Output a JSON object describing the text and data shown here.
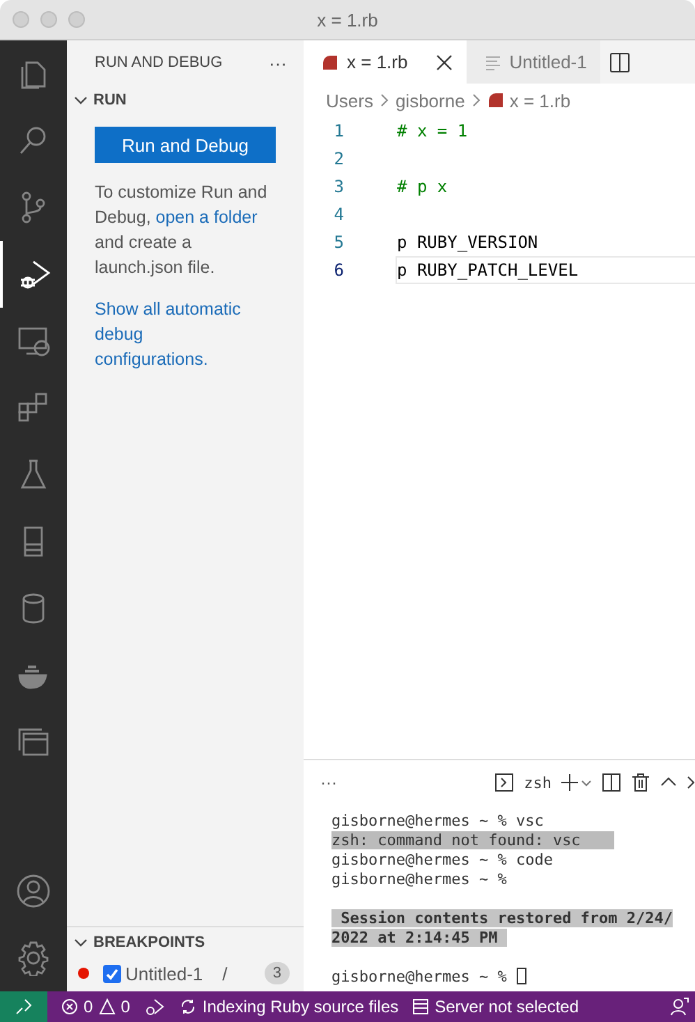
{
  "window": {
    "title": "x = 1.rb"
  },
  "activity_bar": [
    {
      "kind": "files",
      "selected": false
    },
    {
      "kind": "search",
      "selected": false
    },
    {
      "kind": "source-control",
      "selected": false
    },
    {
      "kind": "run-debug",
      "selected": true
    },
    {
      "kind": "remote",
      "selected": false
    },
    {
      "kind": "extensions",
      "selected": false
    },
    {
      "kind": "flask",
      "selected": false
    },
    {
      "kind": "cabinet",
      "selected": false
    },
    {
      "kind": "database",
      "selected": false
    },
    {
      "kind": "docker",
      "selected": false
    },
    {
      "kind": "windows",
      "selected": false
    }
  ],
  "activity_bar_bottom": [
    {
      "kind": "account"
    },
    {
      "kind": "settings"
    }
  ],
  "sidebar": {
    "title": "RUN AND DEBUG",
    "more": "···",
    "section": {
      "title": "RUN",
      "expanded": true
    },
    "button": "Run and Debug",
    "help": [
      {
        "text": "To customize Run and Debug, ",
        "link": false
      },
      {
        "text": "open a folder",
        "link": true
      },
      {
        "text": " and create a launch.json file.",
        "link": false
      }
    ],
    "show_all": "Show all automatic debug configurations.",
    "breakpoints": {
      "title": "BREAKPOINTS",
      "expanded": true,
      "items": [
        {
          "color": "#e51400",
          "checked": true,
          "name": "Untitled-1",
          "path": "/",
          "count": "3"
        }
      ]
    }
  },
  "tabs": [
    {
      "label": "x = 1.rb",
      "kind": "ruby",
      "selected": true
    },
    {
      "label": "Untitled-1",
      "kind": "text",
      "selected": false
    }
  ],
  "breadcrumbs": [
    {
      "label": "Users",
      "kind": "folder"
    },
    {
      "label": "gisborne",
      "kind": "folder"
    },
    {
      "label": "x = 1.rb",
      "kind": "ruby"
    }
  ],
  "code": [
    {
      "number": "1",
      "text": "# x = 1",
      "kind": "comment",
      "selected": false
    },
    {
      "number": "2",
      "kind": "blank",
      "selected": false
    },
    {
      "number": "3",
      "text": "# p x",
      "kind": "comment",
      "selected": false
    },
    {
      "number": "4",
      "kind": "blank",
      "selected": false
    },
    {
      "number": "5",
      "text": "p RUBY_VERSION",
      "kind": "plain",
      "selected": false
    },
    {
      "number": "6",
      "text": "p RUBY_PATCH_LEVEL",
      "kind": "plain",
      "selected": true
    }
  ],
  "terminal": {
    "more": "···",
    "shell": "zsh",
    "lines": [
      {
        "text": "gisborne@hermes ~ % vsc",
        "kind": "plain"
      },
      {
        "text": "zsh: command not found: vsc",
        "kind": "highlight"
      },
      {
        "text": "gisborne@hermes ~ % code",
        "kind": "plain"
      },
      {
        "text": "gisborne@hermes ~ %",
        "kind": "plain"
      },
      {
        "kind": "blank"
      },
      {
        "text": " Session contents restored from 2/24/",
        "kind": "notice"
      },
      {
        "text": "2022 at 2:14:45 PM ",
        "kind": "notice"
      },
      {
        "kind": "blank"
      },
      {
        "text": "gisborne@hermes ~ %",
        "kind": "prompt"
      }
    ]
  },
  "status_bar": {
    "errors": "0",
    "warnings": "0",
    "indexing": "Indexing Ruby source files",
    "server": "Server not selected"
  }
}
